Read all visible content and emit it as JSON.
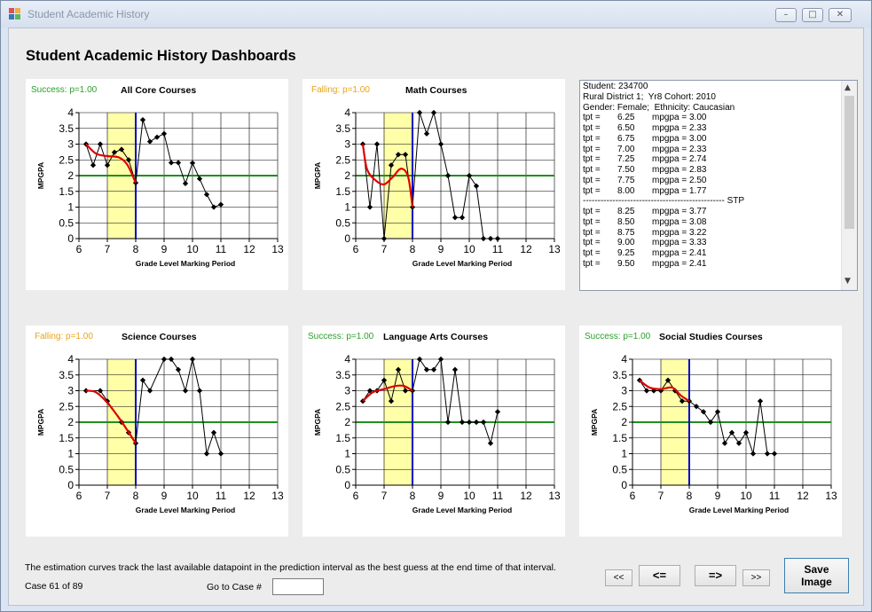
{
  "window": {
    "title": "Student Academic History"
  },
  "heading": "Student Academic History Dashboards",
  "colors": {
    "success": "#2ca02c",
    "falling": "#e8a317",
    "threshold": "#1f8f1f",
    "prediction_band": "#ffffa8",
    "cutoff": "#0000cc",
    "estimate_curve": "#e00000",
    "data_line": "#000000"
  },
  "charts": [
    {
      "status": "Success: p=1.00",
      "status_kind": "success",
      "title": "All Core Courses"
    },
    {
      "status": "Falling: p=1.00",
      "status_kind": "falling",
      "title": "Math Courses"
    },
    {
      "status": "Falling: p=1.00",
      "status_kind": "falling",
      "title": "Science Courses"
    },
    {
      "status": "Success: p=1.00",
      "status_kind": "success",
      "title": "Language Arts Courses"
    },
    {
      "status": "Success: p=1.00",
      "status_kind": "success",
      "title": "Social Studies Courses"
    }
  ],
  "chart_data": [
    {
      "type": "line",
      "title": "All Core Courses",
      "xlabel": "Grade Level Marking Period",
      "ylabel": "MPGPA",
      "xlim": [
        6,
        13
      ],
      "ylim": [
        0,
        4
      ],
      "xticks": [
        "6",
        "7",
        "8",
        "9",
        "10",
        "11",
        "12",
        "13"
      ],
      "yticks": [
        "0",
        "0.5",
        "1",
        "1.5",
        "2",
        "2.5",
        "3",
        "3.5",
        "4"
      ],
      "threshold": 2.0,
      "prediction_band": [
        7,
        8
      ],
      "cutoff": 8,
      "series": [
        {
          "x": [
            6.25,
            6.5,
            6.75,
            7.0,
            7.25,
            7.5,
            7.75,
            8.0,
            8.25,
            8.5,
            8.75,
            9.0,
            9.25,
            9.5,
            9.75,
            10.0,
            10.25,
            10.5,
            10.75,
            11.0
          ],
          "y": [
            3.0,
            2.33,
            3.0,
            2.33,
            2.74,
            2.83,
            2.5,
            1.77,
            3.77,
            3.08,
            3.22,
            3.33,
            2.41,
            2.41,
            1.75,
            2.4,
            1.9,
            1.4,
            1.0,
            1.08
          ]
        }
      ],
      "estimate": {
        "x": [
          6.25,
          6.6,
          7.0,
          7.4,
          7.7,
          8.0
        ],
        "y": [
          3.0,
          2.7,
          2.62,
          2.58,
          2.35,
          1.77
        ]
      }
    },
    {
      "type": "line",
      "title": "Math Courses",
      "xlabel": "Grade Level Marking Period",
      "ylabel": "MPGPA",
      "xlim": [
        6,
        13
      ],
      "ylim": [
        0,
        4
      ],
      "xticks": [
        "6",
        "7",
        "8",
        "9",
        "10",
        "11",
        "12",
        "13"
      ],
      "yticks": [
        "0",
        "0.5",
        "1",
        "1.5",
        "2",
        "2.5",
        "3",
        "3.5",
        "4"
      ],
      "threshold": 2.0,
      "prediction_band": [
        7,
        8
      ],
      "cutoff": 8,
      "series": [
        {
          "x": [
            6.25,
            6.5,
            6.75,
            7.0,
            7.25,
            7.5,
            7.75,
            8.0,
            8.25,
            8.5,
            8.75,
            9.0,
            9.25,
            9.5,
            9.75,
            10.0,
            10.25,
            10.5,
            10.75,
            11.0
          ],
          "y": [
            3.0,
            1.0,
            3.0,
            0.0,
            2.33,
            2.67,
            2.67,
            1.0,
            4.0,
            3.33,
            4.0,
            3.0,
            2.0,
            0.67,
            0.67,
            2.0,
            1.67,
            0.0,
            0.0,
            0.0
          ]
        }
      ],
      "estimate": {
        "x": [
          6.25,
          6.4,
          6.7,
          7.0,
          7.3,
          7.6,
          7.85,
          8.0
        ],
        "y": [
          3.0,
          2.2,
          1.85,
          1.72,
          1.95,
          2.22,
          1.95,
          1.0
        ]
      }
    },
    {
      "type": "line",
      "title": "Science Courses",
      "xlabel": "Grade Level Marking Period",
      "ylabel": "MPGPA",
      "xlim": [
        6,
        13
      ],
      "ylim": [
        0,
        4
      ],
      "xticks": [
        "6",
        "7",
        "8",
        "9",
        "10",
        "11",
        "12",
        "13"
      ],
      "yticks": [
        "0",
        "0.5",
        "1",
        "1.5",
        "2",
        "2.5",
        "3",
        "3.5",
        "4"
      ],
      "threshold": 2.0,
      "prediction_band": [
        7,
        8
      ],
      "cutoff": 8,
      "series": [
        {
          "x": [
            6.25,
            6.75,
            7.0,
            7.5,
            7.75,
            8.0,
            8.25,
            8.5,
            9.0,
            9.25,
            9.5,
            9.75,
            10.0,
            10.25,
            10.5,
            10.75,
            11.0
          ],
          "y": [
            3.0,
            3.0,
            2.67,
            2.0,
            1.67,
            1.33,
            3.33,
            3.0,
            4.0,
            4.0,
            3.67,
            3.0,
            4.0,
            3.0,
            1.0,
            1.67,
            1.0
          ]
        }
      ],
      "estimate": {
        "x": [
          6.25,
          6.6,
          7.0,
          7.4,
          7.7,
          8.0
        ],
        "y": [
          3.0,
          2.95,
          2.62,
          2.15,
          1.75,
          1.33
        ]
      }
    },
    {
      "type": "line",
      "title": "Language Arts Courses",
      "xlabel": "Grade Level Marking Period",
      "ylabel": "MPGPA",
      "xlim": [
        6,
        13
      ],
      "ylim": [
        0,
        4
      ],
      "xticks": [
        "6",
        "7",
        "8",
        "9",
        "10",
        "11",
        "12",
        "13"
      ],
      "yticks": [
        "0",
        "0.5",
        "1",
        "1.5",
        "2",
        "2.5",
        "3",
        "3.5",
        "4"
      ],
      "threshold": 2.0,
      "prediction_band": [
        7,
        8
      ],
      "cutoff": 8,
      "series": [
        {
          "x": [
            6.25,
            6.5,
            6.75,
            7.0,
            7.25,
            7.5,
            7.75,
            8.0,
            8.25,
            8.5,
            8.75,
            9.0,
            9.25,
            9.5,
            9.75,
            10.0,
            10.25,
            10.5,
            10.75,
            11.0
          ],
          "y": [
            2.67,
            3.0,
            3.0,
            3.33,
            2.67,
            3.67,
            3.0,
            3.0,
            4.0,
            3.67,
            3.67,
            4.0,
            2.0,
            3.67,
            2.0,
            2.0,
            2.0,
            2.0,
            1.33,
            2.33
          ]
        }
      ],
      "estimate": {
        "x": [
          6.25,
          6.6,
          7.0,
          7.4,
          7.7,
          8.0
        ],
        "y": [
          2.67,
          2.95,
          3.05,
          3.15,
          3.15,
          3.0
        ]
      }
    },
    {
      "type": "line",
      "title": "Social Studies Courses",
      "xlabel": "Grade Level Marking Period",
      "ylabel": "MPGPA",
      "xlim": [
        6,
        13
      ],
      "ylim": [
        0,
        4
      ],
      "xticks": [
        "6",
        "7",
        "8",
        "9",
        "10",
        "11",
        "12",
        "13"
      ],
      "yticks": [
        "0",
        "0.5",
        "1",
        "1.5",
        "2",
        "2.5",
        "3",
        "3.5",
        "4"
      ],
      "threshold": 2.0,
      "prediction_band": [
        7,
        8
      ],
      "cutoff": 8,
      "series": [
        {
          "x": [
            6.25,
            6.5,
            6.75,
            7.0,
            7.25,
            7.5,
            7.75,
            8.0,
            8.25,
            8.5,
            8.75,
            9.0,
            9.25,
            9.5,
            9.75,
            10.0,
            10.25,
            10.5,
            10.75,
            11.0
          ],
          "y": [
            3.33,
            3.0,
            3.0,
            3.0,
            3.33,
            3.0,
            2.67,
            2.67,
            2.5,
            2.33,
            2.0,
            2.33,
            1.33,
            1.67,
            1.33,
            1.67,
            1.0,
            2.67,
            1.0,
            1.0
          ]
        }
      ],
      "estimate": {
        "x": [
          6.25,
          6.6,
          7.0,
          7.4,
          7.7,
          8.0
        ],
        "y": [
          3.33,
          3.1,
          3.05,
          3.1,
          2.85,
          2.67
        ]
      }
    }
  ],
  "info_panel": {
    "lines": [
      {
        "text": "Student: 234700"
      },
      {
        "text": "Rural District 1;  Yr8 Cohort: 2010"
      },
      {
        "text": "Gender: Female;  Ethnicity: Caucasian"
      },
      {
        "label": "tpt =",
        "tpt": "6.25",
        "mpgpa": "mpgpa = 3.00"
      },
      {
        "label": "tpt =",
        "tpt": "6.50",
        "mpgpa": "mpgpa = 2.33"
      },
      {
        "label": "tpt =",
        "tpt": "6.75",
        "mpgpa": "mpgpa = 3.00"
      },
      {
        "label": "tpt =",
        "tpt": "7.00",
        "mpgpa": "mpgpa = 2.33"
      },
      {
        "label": "tpt =",
        "tpt": "7.25",
        "mpgpa": "mpgpa = 2.74"
      },
      {
        "label": "tpt =",
        "tpt": "7.50",
        "mpgpa": "mpgpa = 2.83"
      },
      {
        "label": "tpt =",
        "tpt": "7.75",
        "mpgpa": "mpgpa = 2.50"
      },
      {
        "label": "tpt =",
        "tpt": "8.00",
        "mpgpa": "mpgpa = 1.77"
      },
      {
        "text": "------------------------------------------------ STP"
      },
      {
        "label": "tpt =",
        "tpt": "8.25",
        "mpgpa": "mpgpa = 3.77"
      },
      {
        "label": "tpt =",
        "tpt": "8.50",
        "mpgpa": "mpgpa = 3.08"
      },
      {
        "label": "tpt =",
        "tpt": "8.75",
        "mpgpa": "mpgpa = 3.22"
      },
      {
        "label": "tpt =",
        "tpt": "9.00",
        "mpgpa": "mpgpa = 3.33"
      },
      {
        "label": "tpt =",
        "tpt": "9.25",
        "mpgpa": "mpgpa = 2.41"
      },
      {
        "label": "tpt =",
        "tpt": "9.50",
        "mpgpa": "mpgpa = 2.41"
      }
    ],
    "scroll_up": "▲",
    "scroll_down": "▼"
  },
  "footer": {
    "note": "The estimation curves track the last available datapoint in the prediction interval as the best guess at the end time of that interval.",
    "case": "Case 61 of 89",
    "goto_label": "Go to Case #",
    "goto_value": ""
  },
  "nav": {
    "first": "<<",
    "prev": "<=",
    "next": "=>",
    "last": ">>",
    "save_line1": "Save",
    "save_line2": "Image"
  }
}
